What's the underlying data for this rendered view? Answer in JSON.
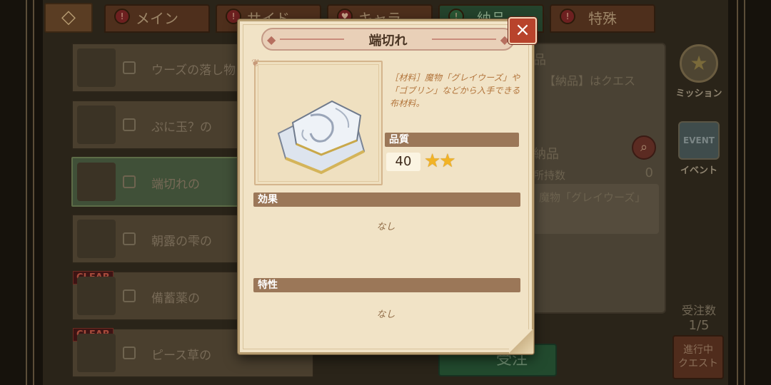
{
  "background": {
    "tabs": [
      {
        "label": "メイン",
        "active": false
      },
      {
        "label": "サイド",
        "active": false
      },
      {
        "label": "キャラ",
        "active": false
      },
      {
        "label": "納品",
        "active": true
      },
      {
        "label": "特殊",
        "active": false
      }
    ],
    "quest_list": [
      {
        "name": "ウーズの落し物",
        "clear": false,
        "selected": false
      },
      {
        "name": "ぷに玉？の",
        "clear": false,
        "selected": false
      },
      {
        "name": "端切れの",
        "clear": false,
        "selected": true
      },
      {
        "name": "朝露の雫の",
        "clear": false,
        "selected": false
      },
      {
        "name": "備蓄薬の",
        "clear": true,
        "selected": false
      },
      {
        "name": "ピース草の",
        "clear": true,
        "selected": false
      }
    ],
    "clear_label": "CLEAR",
    "right_panel": {
      "header": "品",
      "note": "【納品】はクエス",
      "label": "納品",
      "count_label": "所持数",
      "count": "0",
      "target": "魔物「グレイウーズ」"
    },
    "order_button": "受注",
    "side_buttons": {
      "mission": "ミッション",
      "event": "イベント",
      "event_banner": "EVENT"
    },
    "quota_label": "受注数",
    "quota_value": "1/5",
    "progress_button": "進行中\nクエスト"
  },
  "modal": {
    "title": "端切れ",
    "close_label": "×",
    "description": "［材料］魔物「グレイウーズ」や「ゴブリン」などから入手できる布材料。",
    "quality_label": "品質",
    "quality_value": "40",
    "stars": "★★",
    "star_count": 2,
    "effect_label": "効果",
    "effect_value": "なし",
    "trait_label": "特性",
    "trait_value": "なし"
  },
  "icons": {
    "back": "diamond-ornament-icon",
    "close": "close-icon",
    "search": "search-icon",
    "item": "cloth-scrap-icon",
    "star": "star-icon"
  }
}
